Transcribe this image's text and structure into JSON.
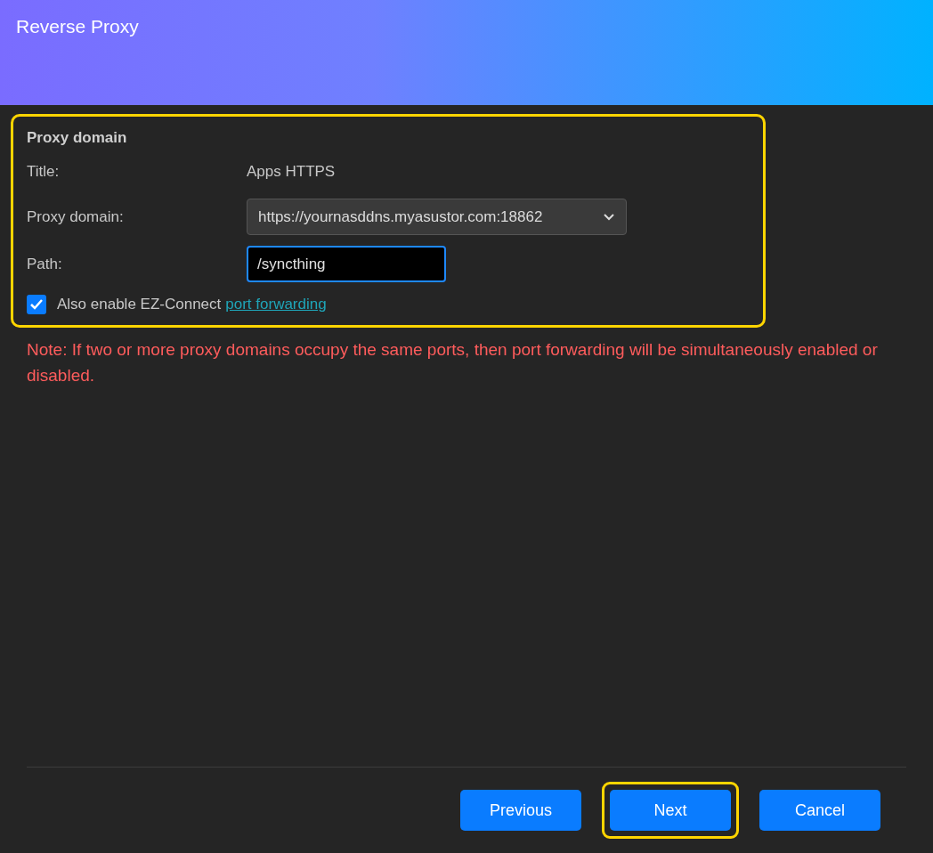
{
  "window": {
    "title": "Reverse Proxy"
  },
  "section": {
    "heading": "Proxy domain",
    "highlighted": true,
    "fields": [
      {
        "kind": "text",
        "label": "Title:",
        "value": "Apps HTTPS"
      },
      {
        "kind": "select",
        "label": "Proxy domain:",
        "value": "https://yournasddns.myasustor.com:18862"
      },
      {
        "kind": "input",
        "label": "Path:",
        "value": "/syncthing",
        "focused": true
      }
    ],
    "checkbox": {
      "label": "Also enable EZ-Connect",
      "link": "port forwarding",
      "checked": true
    }
  },
  "note": "Note: If two or more proxy domains occupy the same ports, then port forwarding will be simultaneously enabled or disabled.",
  "buttons": [
    {
      "label": "Previous",
      "highlighted": false
    },
    {
      "label": "Next",
      "highlighted": true
    },
    {
      "label": "Cancel",
      "highlighted": false
    }
  ]
}
